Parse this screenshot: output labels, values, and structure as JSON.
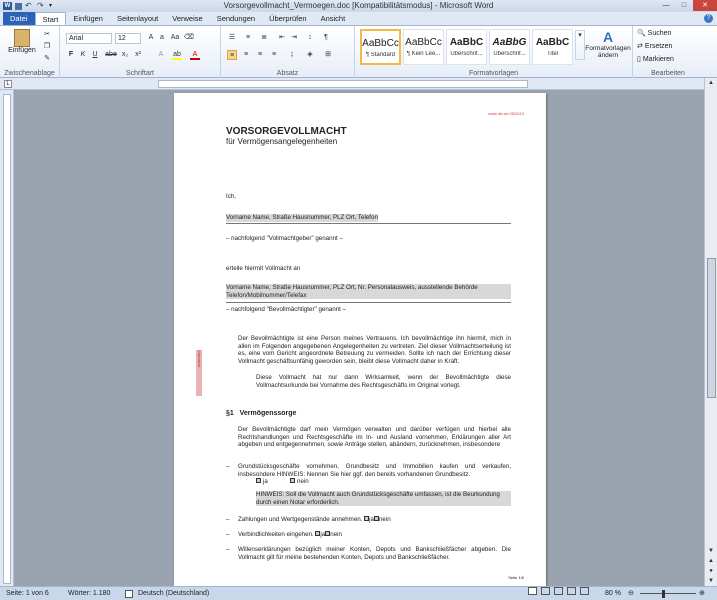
{
  "window": {
    "title": "Vorsorgevollmacht_Vermoegen.doc [Kompatibilitätsmodus] - Microsoft Word",
    "qat_icons": [
      "word-icon",
      "save-icon",
      "undo-icon",
      "redo-icon",
      "customize-icon"
    ]
  },
  "tabs": [
    {
      "label": "Datei"
    },
    {
      "label": "Start"
    },
    {
      "label": "Einfügen"
    },
    {
      "label": "Seitenlayout"
    },
    {
      "label": "Verweise"
    },
    {
      "label": "Sendungen"
    },
    {
      "label": "Überprüfen"
    },
    {
      "label": "Ansicht"
    }
  ],
  "ribbon": {
    "clipboard": {
      "label": "Zwischenablage",
      "paste": "Einfügen"
    },
    "font": {
      "label": "Schriftart",
      "family": "Arial",
      "size": "12",
      "buttons": [
        "F",
        "K",
        "U",
        "abe",
        "x₂",
        "x²"
      ]
    },
    "paragraph": {
      "label": "Absatz"
    },
    "styles": {
      "label": "Formatvorlagen",
      "items": [
        {
          "preview": "AaBbCc",
          "name": "¶ Standard"
        },
        {
          "preview": "AaBbCc",
          "name": "¶ Kein Lee..."
        },
        {
          "preview": "AaBbC",
          "name": "Überschrif..."
        },
        {
          "preview": "AaBbG",
          "name": "Überschrif..."
        },
        {
          "preview": "AaBbC",
          "name": "Titel"
        }
      ],
      "change": "Formatvorlagen ändern"
    },
    "editing": {
      "label": "Bearbeiten",
      "find": "Suchen",
      "replace": "Ersetzen",
      "select": "Markieren"
    }
  },
  "document": {
    "header_right": "www.dtv.de  05/2013",
    "title": "VORSORGEVOLLMACHT",
    "subtitle": "für Vermögensangelegenheiten",
    "ich": "Ich,",
    "field1": "Vorname Name, Straße Hausnummer, PLZ Ort, Telefon",
    "nach1": "– nachfolgend \"Vollmachtgeber\" genannt –",
    "erteile": "erteile hiermit Vollmacht an",
    "field2": "Vorname Name, Straße Hausnummer, PLZ Ort, Nr. Personalausweis, ausstellende Behörde Telefon/Mobilnummer/Telefax",
    "nach2": "– nachfolgend \"Bevollmächtigter\" genannt –",
    "para1": "Der Bevollmächtigte ist eine Person meines Vertrauens. Ich bevollmächtige ihn hiermit, mich in allen im Folgenden angegebenen Angelegenheiten zu vertreten. Ziel dieser Vollmachtserteilung ist es, eine vom Gericht angeordnete Betreuung zu vermeiden. Sollte ich nach der Errichtung dieser Vollmacht geschäftsunfähig geworden sein, bleibt diese Vollmacht daher in Kraft.",
    "para2": "Diese Vollmacht hat nur dann Wirksamkeit, wenn der Bevollmächtigte diese Vollmachtsurkunde bei Vornahme des Rechtsgeschäfts im Original vorlegt.",
    "section": "§1   Vermögenssorge",
    "para3": "Der Bevollmächtigte darf mein Vermögen verwalten und darüber verfügen und hierbei alle Rechtshandlungen und Rechtsgeschäfte im In- und Ausland vornehmen, Erklärungen aller Art abgeben und entgegennehmen, sowie Anträge stellen, abändern, zurücknehmen, insbesondere",
    "item1": "Grundstücksgeschäfte vornehmen, Grundbesitz und Immobilien kaufen und verkaufen, insbesondere HINWEIS: Nennen Sie hier ggf. den bereits vorhandenen Grundbesitz.",
    "ja": "ja",
    "nein": "nein",
    "hinweis": "HINWEIS: Soll die Vollmacht auch Grundstücksgeschäfte umfassen, ist die Beurkundung durch einen Notar erforderlich.",
    "item2": "Zahlungen und Wertgegenstände annehmen.",
    "item3": "Verbindlichkeiten eingehen.",
    "item4": "Willenserklärungen bezüglich meiner Konten, Depots und Bankschließfächer abgeben. Die Vollmacht gilt für meine bestehenden Konten, Depots und Bankschließfächer.",
    "dash": "–",
    "footer": "Seite 1/6",
    "margin_note": "Vollmacht"
  },
  "status": {
    "page": "Seite: 1 von 6",
    "words": "Wörter: 1.180",
    "language": "Deutsch (Deutschland)",
    "zoom": "80 %"
  }
}
